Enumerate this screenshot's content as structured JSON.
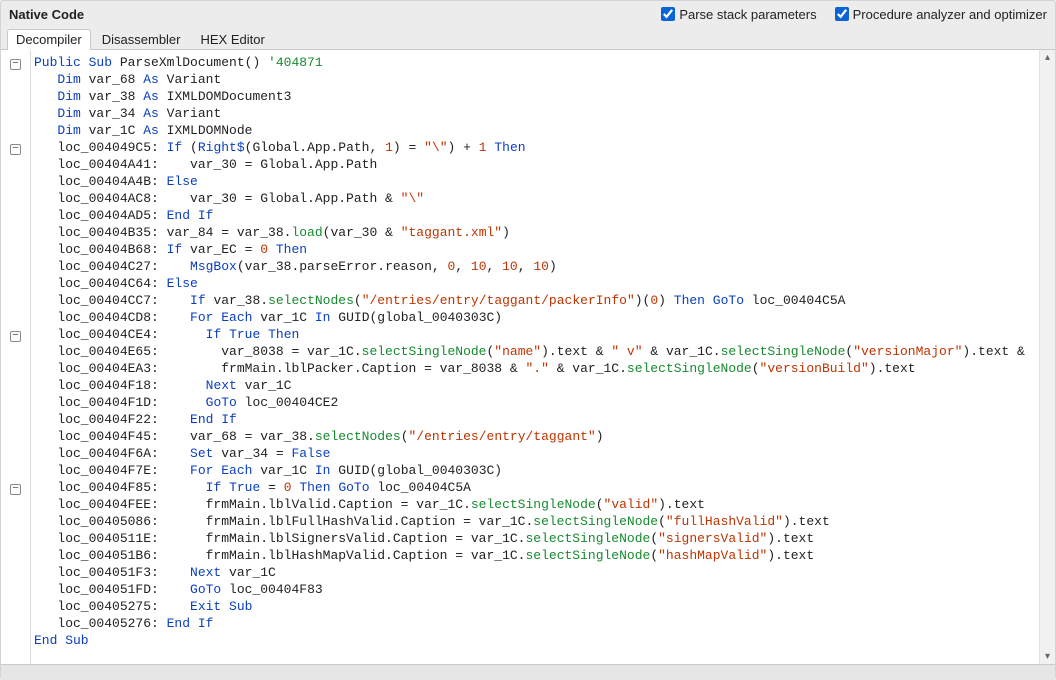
{
  "header": {
    "title": "Native Code",
    "options": {
      "parse_stack": {
        "label": "Parse stack parameters",
        "checked": true
      },
      "analyzer": {
        "label": "Procedure analyzer and optimizer",
        "checked": true
      }
    }
  },
  "tabs": {
    "items": [
      {
        "label": "Decompiler",
        "active": true
      },
      {
        "label": "Disassembler",
        "active": false
      },
      {
        "label": "HEX Editor",
        "active": false
      }
    ]
  },
  "code": {
    "lines": [
      {
        "fold": true,
        "tokens": [
          {
            "t": "Public Sub",
            "c": "kw"
          },
          {
            "t": " ParseXmlDocument() "
          },
          {
            "t": "'404871",
            "c": "cm"
          }
        ]
      },
      {
        "tokens": [
          {
            "t": "   "
          },
          {
            "t": "Dim",
            "c": "kw"
          },
          {
            "t": " var_68 "
          },
          {
            "t": "As",
            "c": "kw"
          },
          {
            "t": " Variant"
          }
        ]
      },
      {
        "tokens": [
          {
            "t": "   "
          },
          {
            "t": "Dim",
            "c": "kw"
          },
          {
            "t": " var_38 "
          },
          {
            "t": "As",
            "c": "kw"
          },
          {
            "t": " IXMLDOMDocument3"
          }
        ]
      },
      {
        "tokens": [
          {
            "t": "   "
          },
          {
            "t": "Dim",
            "c": "kw"
          },
          {
            "t": " var_34 "
          },
          {
            "t": "As",
            "c": "kw"
          },
          {
            "t": " Variant"
          }
        ]
      },
      {
        "tokens": [
          {
            "t": "   "
          },
          {
            "t": "Dim",
            "c": "kw"
          },
          {
            "t": " var_1C "
          },
          {
            "t": "As",
            "c": "kw"
          },
          {
            "t": " IXMLDOMNode"
          }
        ]
      },
      {
        "fold": true,
        "tokens": [
          {
            "t": "   loc_004049C5: "
          },
          {
            "t": "If",
            "c": "kw"
          },
          {
            "t": " ("
          },
          {
            "t": "Right$",
            "c": "kw"
          },
          {
            "t": "(Global.App.Path, "
          },
          {
            "t": "1",
            "c": "num"
          },
          {
            "t": ") = "
          },
          {
            "t": "\"\\\"",
            "c": "str"
          },
          {
            "t": ") + "
          },
          {
            "t": "1",
            "c": "num"
          },
          {
            "t": " "
          },
          {
            "t": "Then",
            "c": "kw"
          }
        ]
      },
      {
        "tokens": [
          {
            "t": "   loc_00404A41:    var_30 = Global.App.Path"
          }
        ]
      },
      {
        "tokens": [
          {
            "t": "   loc_00404A4B: "
          },
          {
            "t": "Else",
            "c": "kw"
          }
        ]
      },
      {
        "tokens": [
          {
            "t": "   loc_00404AC8:    var_30 = Global.App.Path & "
          },
          {
            "t": "\"\\\"",
            "c": "str"
          }
        ]
      },
      {
        "tokens": [
          {
            "t": "   loc_00404AD5: "
          },
          {
            "t": "End If",
            "c": "kw"
          }
        ]
      },
      {
        "tokens": [
          {
            "t": "   loc_00404B35: var_84 = var_38."
          },
          {
            "t": "load",
            "c": "fn"
          },
          {
            "t": "(var_30 & "
          },
          {
            "t": "\"taggant.xml\"",
            "c": "str"
          },
          {
            "t": ")"
          }
        ]
      },
      {
        "tokens": [
          {
            "t": "   loc_00404B68: "
          },
          {
            "t": "If",
            "c": "kw"
          },
          {
            "t": " var_EC = "
          },
          {
            "t": "0",
            "c": "num"
          },
          {
            "t": " "
          },
          {
            "t": "Then",
            "c": "kw"
          }
        ]
      },
      {
        "tokens": [
          {
            "t": "   loc_00404C27:    "
          },
          {
            "t": "MsgBox",
            "c": "kw"
          },
          {
            "t": "(var_38.parseError.reason, "
          },
          {
            "t": "0",
            "c": "num"
          },
          {
            "t": ", "
          },
          {
            "t": "10",
            "c": "num"
          },
          {
            "t": ", "
          },
          {
            "t": "10",
            "c": "num"
          },
          {
            "t": ", "
          },
          {
            "t": "10",
            "c": "num"
          },
          {
            "t": ")"
          }
        ]
      },
      {
        "tokens": [
          {
            "t": "   loc_00404C64: "
          },
          {
            "t": "Else",
            "c": "kw"
          }
        ]
      },
      {
        "tokens": [
          {
            "t": "   loc_00404CC7:    "
          },
          {
            "t": "If",
            "c": "kw"
          },
          {
            "t": " var_38."
          },
          {
            "t": "selectNodes",
            "c": "fn"
          },
          {
            "t": "("
          },
          {
            "t": "\"/entries/entry/taggant/packerInfo\"",
            "c": "str"
          },
          {
            "t": ")("
          },
          {
            "t": "0",
            "c": "num"
          },
          {
            "t": ") "
          },
          {
            "t": "Then GoTo",
            "c": "kw"
          },
          {
            "t": " loc_00404C5A"
          }
        ]
      },
      {
        "tokens": [
          {
            "t": "   loc_00404CD8:    "
          },
          {
            "t": "For Each",
            "c": "kw"
          },
          {
            "t": " var_1C "
          },
          {
            "t": "In",
            "c": "kw"
          },
          {
            "t": " GUID(global_0040303C)"
          }
        ]
      },
      {
        "fold": true,
        "tokens": [
          {
            "t": "   loc_00404CE4:      "
          },
          {
            "t": "If",
            "c": "kw"
          },
          {
            "t": " "
          },
          {
            "t": "True",
            "c": "kw"
          },
          {
            "t": " "
          },
          {
            "t": "Then",
            "c": "kw"
          }
        ]
      },
      {
        "tokens": [
          {
            "t": "   loc_00404E65:        var_8038 = var_1C."
          },
          {
            "t": "selectSingleNode",
            "c": "fn"
          },
          {
            "t": "("
          },
          {
            "t": "\"name\"",
            "c": "str"
          },
          {
            "t": ").text & "
          },
          {
            "t": "\" v\"",
            "c": "str"
          },
          {
            "t": " & var_1C."
          },
          {
            "t": "selectSingleNode",
            "c": "fn"
          },
          {
            "t": "("
          },
          {
            "t": "\"versionMajor\"",
            "c": "str"
          },
          {
            "t": ").text &"
          }
        ]
      },
      {
        "tokens": [
          {
            "t": "   loc_00404EA3:        frmMain.lblPacker.Caption = var_8038 & "
          },
          {
            "t": "\".\"",
            "c": "str"
          },
          {
            "t": " & var_1C."
          },
          {
            "t": "selectSingleNode",
            "c": "fn"
          },
          {
            "t": "("
          },
          {
            "t": "\"versionBuild\"",
            "c": "str"
          },
          {
            "t": ").text"
          }
        ]
      },
      {
        "tokens": [
          {
            "t": "   loc_00404F18:      "
          },
          {
            "t": "Next",
            "c": "kw"
          },
          {
            "t": " var_1C"
          }
        ]
      },
      {
        "tokens": [
          {
            "t": "   loc_00404F1D:      "
          },
          {
            "t": "GoTo",
            "c": "kw"
          },
          {
            "t": " loc_00404CE2"
          }
        ]
      },
      {
        "tokens": [
          {
            "t": "   loc_00404F22:    "
          },
          {
            "t": "End If",
            "c": "kw"
          }
        ]
      },
      {
        "tokens": [
          {
            "t": "   loc_00404F45:    var_68 = var_38."
          },
          {
            "t": "selectNodes",
            "c": "fn"
          },
          {
            "t": "("
          },
          {
            "t": "\"/entries/entry/taggant\"",
            "c": "str"
          },
          {
            "t": ")"
          }
        ]
      },
      {
        "tokens": [
          {
            "t": "   loc_00404F6A:    "
          },
          {
            "t": "Set",
            "c": "kw"
          },
          {
            "t": " var_34 = "
          },
          {
            "t": "False",
            "c": "kw"
          }
        ]
      },
      {
        "tokens": [
          {
            "t": "   loc_00404F7E:    "
          },
          {
            "t": "For Each",
            "c": "kw"
          },
          {
            "t": " var_1C "
          },
          {
            "t": "In",
            "c": "kw"
          },
          {
            "t": " GUID(global_0040303C)"
          }
        ]
      },
      {
        "fold": true,
        "tokens": [
          {
            "t": "   loc_00404F85:      "
          },
          {
            "t": "If",
            "c": "kw"
          },
          {
            "t": " "
          },
          {
            "t": "True",
            "c": "kw"
          },
          {
            "t": " = "
          },
          {
            "t": "0",
            "c": "num"
          },
          {
            "t": " "
          },
          {
            "t": "Then GoTo",
            "c": "kw"
          },
          {
            "t": " loc_00404C5A"
          }
        ]
      },
      {
        "tokens": [
          {
            "t": "   loc_00404FEE:      frmMain.lblValid.Caption = var_1C."
          },
          {
            "t": "selectSingleNode",
            "c": "fn"
          },
          {
            "t": "("
          },
          {
            "t": "\"valid\"",
            "c": "str"
          },
          {
            "t": ").text"
          }
        ]
      },
      {
        "tokens": [
          {
            "t": "   loc_00405086:      frmMain.lblFullHashValid.Caption = var_1C."
          },
          {
            "t": "selectSingleNode",
            "c": "fn"
          },
          {
            "t": "("
          },
          {
            "t": "\"fullHashValid\"",
            "c": "str"
          },
          {
            "t": ").text"
          }
        ]
      },
      {
        "tokens": [
          {
            "t": "   loc_0040511E:      frmMain.lblSignersValid.Caption = var_1C."
          },
          {
            "t": "selectSingleNode",
            "c": "fn"
          },
          {
            "t": "("
          },
          {
            "t": "\"signersValid\"",
            "c": "str"
          },
          {
            "t": ").text"
          }
        ]
      },
      {
        "tokens": [
          {
            "t": "   loc_004051B6:      frmMain.lblHashMapValid.Caption = var_1C."
          },
          {
            "t": "selectSingleNode",
            "c": "fn"
          },
          {
            "t": "("
          },
          {
            "t": "\"hashMapValid\"",
            "c": "str"
          },
          {
            "t": ").text"
          }
        ]
      },
      {
        "tokens": [
          {
            "t": "   loc_004051F3:    "
          },
          {
            "t": "Next",
            "c": "kw"
          },
          {
            "t": " var_1C"
          }
        ]
      },
      {
        "tokens": [
          {
            "t": "   loc_004051FD:    "
          },
          {
            "t": "GoTo",
            "c": "kw"
          },
          {
            "t": " loc_00404F83"
          }
        ]
      },
      {
        "tokens": [
          {
            "t": "   loc_00405275:    "
          },
          {
            "t": "Exit Sub",
            "c": "kw"
          }
        ]
      },
      {
        "tokens": [
          {
            "t": "   loc_00405276: "
          },
          {
            "t": "End If",
            "c": "kw"
          }
        ]
      },
      {
        "tokens": [
          {
            "t": "End Sub",
            "c": "kw"
          }
        ]
      }
    ]
  }
}
